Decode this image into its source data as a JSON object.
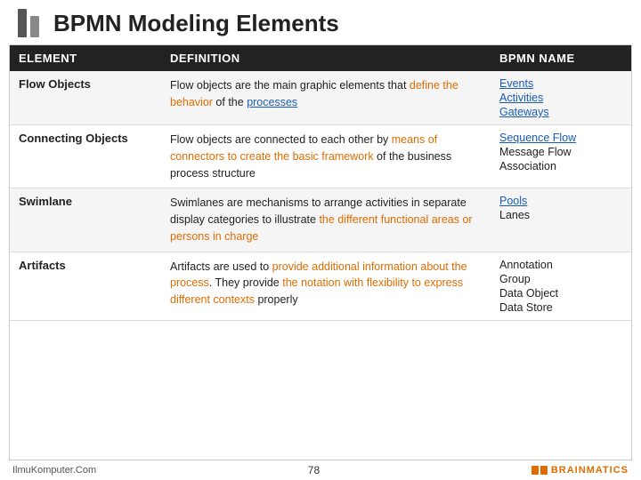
{
  "header": {
    "title": "BPMN Modeling Elements"
  },
  "table": {
    "columns": [
      {
        "id": "element",
        "label": "ELEMENT"
      },
      {
        "id": "definition",
        "label": "DEFINITION"
      },
      {
        "id": "bpmn_name",
        "label": "BPMN NAME"
      }
    ],
    "rows": [
      {
        "element": "Flow Objects",
        "definition_parts": [
          {
            "text": "Flow objects are the main graphic elements that ",
            "type": "plain"
          },
          {
            "text": "define the behavior",
            "type": "orange"
          },
          {
            "text": " of the ",
            "type": "plain"
          },
          {
            "text": "processes",
            "type": "link"
          }
        ],
        "bpmn_names": [
          {
            "text": "Events",
            "type": "link"
          },
          {
            "text": "Activities",
            "type": "link"
          },
          {
            "text": "Gateways",
            "type": "link"
          }
        ]
      },
      {
        "element": "Connecting Objects",
        "definition_parts": [
          {
            "text": "Flow objects are connected to each other by ",
            "type": "plain"
          },
          {
            "text": "means of connectors to create the basic framework",
            "type": "orange"
          },
          {
            "text": " of the business process structure",
            "type": "plain"
          }
        ],
        "bpmn_names": [
          {
            "text": "Sequence Flow",
            "type": "link"
          },
          {
            "text": "Message Flow",
            "type": "plain"
          },
          {
            "text": "Association",
            "type": "plain"
          }
        ]
      },
      {
        "element": "Swimlane",
        "definition_parts": [
          {
            "text": "Swimlanes are mechanisms to arrange activities in separate display categories to illustrate ",
            "type": "plain"
          },
          {
            "text": "the different functional areas or persons in charge",
            "type": "orange"
          }
        ],
        "bpmn_names": [
          {
            "text": "Pools",
            "type": "link"
          },
          {
            "text": "Lanes",
            "type": "plain"
          }
        ]
      },
      {
        "element": "Artifacts",
        "definition_parts": [
          {
            "text": "Artifacts are used to ",
            "type": "plain"
          },
          {
            "text": "provide additional information about the process",
            "type": "orange"
          },
          {
            "text": ". They provide ",
            "type": "plain"
          },
          {
            "text": "the notation with flexibility to express different contexts",
            "type": "orange"
          },
          {
            "text": " properly",
            "type": "plain"
          }
        ],
        "bpmn_names": [
          {
            "text": "Annotation",
            "type": "plain"
          },
          {
            "text": "Group",
            "type": "plain"
          },
          {
            "text": "Data Object",
            "type": "plain"
          },
          {
            "text": "Data Store",
            "type": "plain"
          }
        ]
      }
    ]
  },
  "footer": {
    "left": "IlmuKomputer.Com",
    "page": "78",
    "logo_text": "BRAINMATICS"
  }
}
